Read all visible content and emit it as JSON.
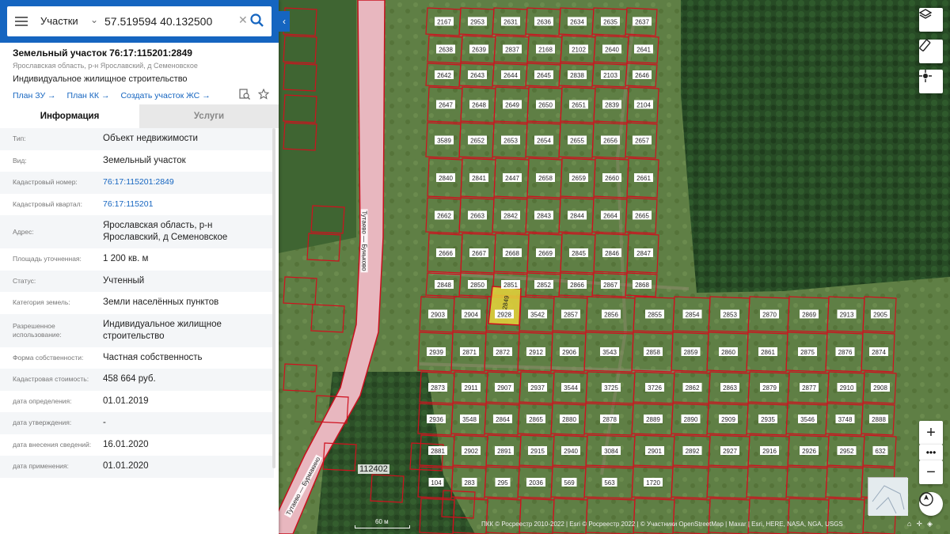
{
  "search": {
    "layer": "Участки",
    "coordinates": "57.519594 40.132500"
  },
  "parcel": {
    "title": "Земельный участок 76:17:115201:2849",
    "address_short": "Ярославская область, р-н Ярославский, д Семеновское",
    "use": "Индивидуальное жилищное строительство",
    "links": [
      "План ЗУ",
      "План КК",
      "Создать участок ЖС"
    ]
  },
  "tabs": [
    "Информация",
    "Услуги"
  ],
  "properties": [
    {
      "key": "Тип:",
      "value": "Объект недвижимости"
    },
    {
      "key": "Вид:",
      "value": "Земельный участок"
    },
    {
      "key": "Кадастровый номер:",
      "value": "76:17:115201:2849",
      "link": true
    },
    {
      "key": "Кадастровый квартал:",
      "value": "76:17:115201",
      "link": true
    },
    {
      "key": "Адрес:",
      "value": "Ярославская область, р-н Ярославский, д Семеновское"
    },
    {
      "key": "Площадь уточненная:",
      "value": "1 200 кв. м"
    },
    {
      "key": "Статус:",
      "value": "Учтенный"
    },
    {
      "key": "Категория земель:",
      "value": "Земли населённых пунктов"
    },
    {
      "key": "Разрешенное использование:",
      "value": "Индивидуальное жилищное строительство"
    },
    {
      "key": "Форма собственности:",
      "value": "Частная собственность"
    },
    {
      "key": "Кадастровая стоимость:",
      "value": "458 664 руб."
    },
    {
      "key": "дата определения:",
      "value": "01.01.2019"
    },
    {
      "key": "дата утверждения:",
      "value": "-"
    },
    {
      "key": "дата внесения сведений:",
      "value": "16.01.2020"
    },
    {
      "key": "дата применения:",
      "value": "01.01.2020"
    }
  ],
  "map": {
    "scale_label": "60 м",
    "attribution": "ПКК © Росреестр 2010-2022 | Esri © Росреестр 2022 | © Участники OpenStreetMap | Maxar | Esri, HERE, NASA, NGA, USGS",
    "road_labels": [
      "Тутаево — Буньково",
      "Тутаево — Бурмакино"
    ],
    "quarter_label": "112402",
    "selected_plot": "2849",
    "plots": [
      "2167",
      "2953",
      "2631",
      "2636",
      "2634",
      "2635",
      "2637",
      "2638",
      "2639",
      "2837",
      "2168",
      "2102",
      "2640",
      "2641",
      "2642",
      "2643",
      "2644",
      "2645",
      "2838",
      "2103",
      "2646",
      "2647",
      "2648",
      "2649",
      "2650",
      "2651",
      "2839",
      "2104",
      "3589",
      "2652",
      "2653",
      "2654",
      "2655",
      "2656",
      "2657",
      "2840",
      "2841",
      "2447",
      "2658",
      "2659",
      "2660",
      "2661",
      "2662",
      "2663",
      "2842",
      "2843",
      "2844",
      "2664",
      "2665",
      "2666",
      "2667",
      "2668",
      "2669",
      "2845",
      "2846",
      "2847",
      "2848",
      "2850",
      "2851",
      "2852",
      "2866",
      "2867",
      "2868",
      "2903",
      "2904",
      "2928",
      "3542",
      "2857",
      "2856",
      "2855",
      "2854",
      "2853",
      "2870",
      "2869",
      "2913",
      "2905",
      "2939",
      "2871",
      "2872",
      "2912",
      "2906",
      "3543",
      "2858",
      "2859",
      "2860",
      "2861",
      "2875",
      "2876",
      "2874",
      "2873",
      "2911",
      "2907",
      "2937",
      "3544",
      "3725",
      "3726",
      "2862",
      "2863",
      "2879",
      "2877",
      "2910",
      "2908",
      "2936",
      "3548",
      "2864",
      "2865",
      "2880",
      "2878",
      "2889",
      "2890",
      "2909",
      "2935",
      "3546",
      "3748",
      "2888",
      "2881",
      "2902",
      "2891",
      "2915",
      "2940",
      "3084",
      "2901",
      "2892",
      "2927",
      "2916",
      "2926",
      "2952",
      "632",
      "104",
      "283",
      "295",
      "2036",
      "569",
      "563",
      "1720"
    ]
  }
}
